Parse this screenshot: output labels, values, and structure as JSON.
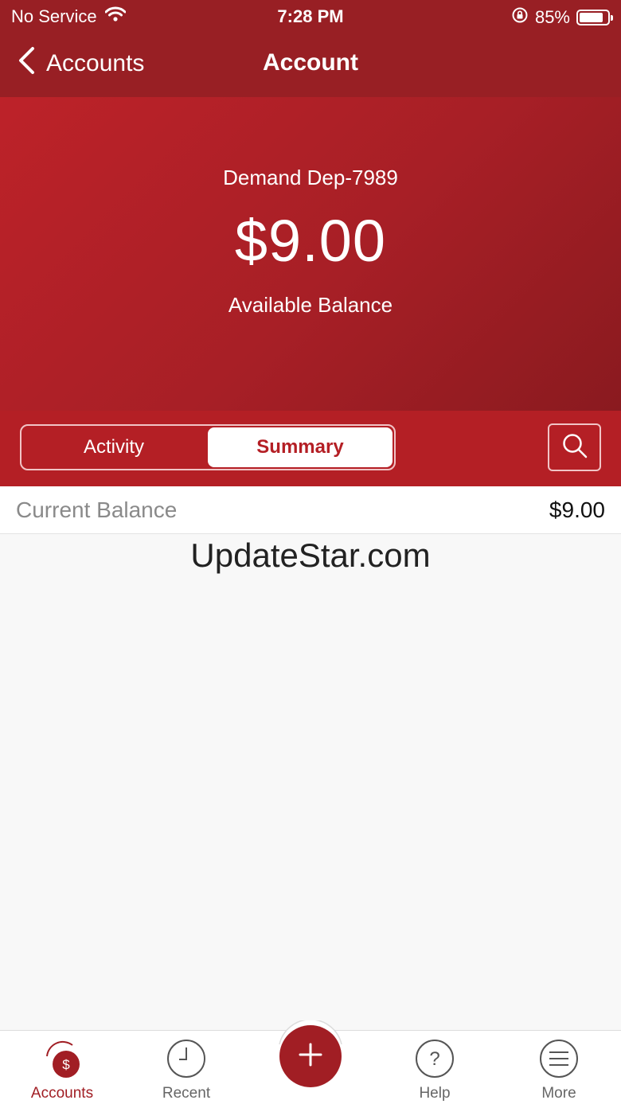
{
  "status_bar": {
    "carrier": "No Service",
    "time": "7:28 PM",
    "battery_percent": "85%",
    "battery_level": 0.85
  },
  "nav": {
    "back_label": "Accounts",
    "title": "Account"
  },
  "account": {
    "name": "Demand Dep-7989",
    "balance": "$9.00",
    "balance_label": "Available Balance"
  },
  "segments": [
    {
      "label": "Activity",
      "active": false
    },
    {
      "label": "Summary",
      "active": true
    }
  ],
  "summary_rows": [
    {
      "label": "Current Balance",
      "value": "$9.00"
    }
  ],
  "watermark": "UpdateStar.com",
  "tabs": [
    {
      "label": "Accounts",
      "icon": "accounts-dollar-icon",
      "active": true
    },
    {
      "label": "Recent",
      "icon": "clock-icon",
      "active": false
    },
    {
      "label": "Help",
      "icon": "question-icon",
      "active": false
    },
    {
      "label": "More",
      "icon": "menu-icon",
      "active": false
    }
  ],
  "colors": {
    "brand_red": "#a11e24",
    "header_red": "#981f24",
    "segment_bar_red": "#b41f25"
  }
}
